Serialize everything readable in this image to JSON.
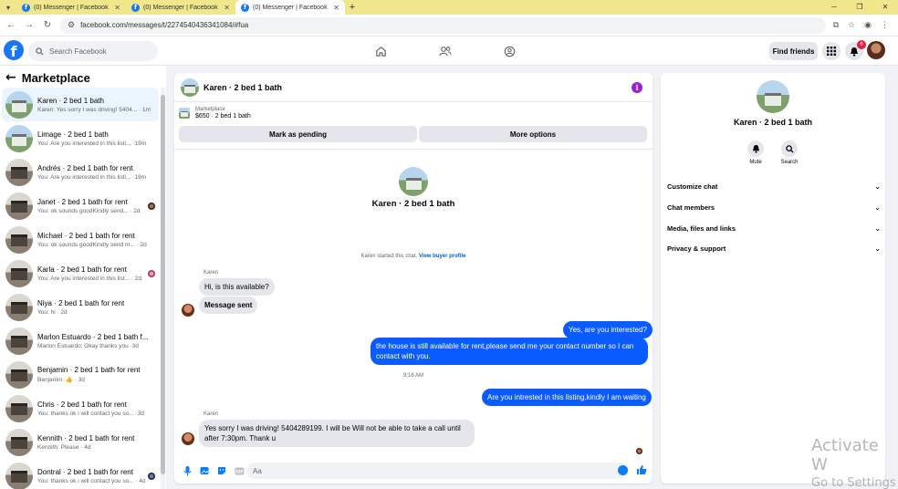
{
  "browser": {
    "tabs": [
      {
        "title": "(0) Messenger | Facebook"
      },
      {
        "title": "(0) Messenger | Facebook"
      },
      {
        "title": "(0) Messenger | Facebook"
      }
    ],
    "new_tab": "+",
    "url": "facebook.com/messages/t/2274540436341084/#fua"
  },
  "fb": {
    "logo": "f",
    "search_placeholder": "Search Facebook",
    "find_friends": "Find friends",
    "notifications_count": "6"
  },
  "sidebar": {
    "title": "Marketplace",
    "conversations": [
      {
        "name": "Karen · 2 bed 1 bath",
        "preview": "Karen: Yes sorry I was driving! 5404... · 1m",
        "thumb": "house",
        "selected": true,
        "mini": ""
      },
      {
        "name": "Limage · 2 bed 1 bath",
        "preview": "You: Are you interested in this listi... ·19m",
        "thumb": "house",
        "selected": false,
        "mini": ""
      },
      {
        "name": "Andrés · 2 bed 1 bath for rent",
        "preview": "You: Are you interested in this listi... ·19m",
        "thumb": "bw",
        "selected": false,
        "mini": ""
      },
      {
        "name": "Janet · 2 bed 1 bath for rent",
        "preview": "You: ok sounds goodKindly send... · 2d",
        "thumb": "bw",
        "selected": false,
        "mini": "brown"
      },
      {
        "name": "Michael · 2 bed 1 bath for rent",
        "preview": "You: ok sounds goodKindly send m... · 2d",
        "thumb": "bw",
        "selected": false,
        "mini": ""
      },
      {
        "name": "Karla · 2 bed 1 bath for rent",
        "preview": "You: Are you interested in this list... · 2d",
        "thumb": "bw",
        "selected": false,
        "mini": "pink"
      },
      {
        "name": "Niya · 2 bed 1 bath for rent",
        "preview": "You: hi · 2d",
        "thumb": "bw",
        "selected": false,
        "mini": ""
      },
      {
        "name": "Marlon Estuardo · 2 bed 1 bath f...",
        "preview": "Marlon Estuardo: Okay thanks you ·3d",
        "thumb": "bw",
        "selected": false,
        "mini": ""
      },
      {
        "name": "Benjamin · 2 bed 1 bath for rent",
        "preview": "Benjamin: 👍 · 3d",
        "thumb": "bw",
        "selected": false,
        "mini": ""
      },
      {
        "name": "Chris · 2 bed 1 bath for rent",
        "preview": "You: thanks ok i will contact you so... ·3d",
        "thumb": "bw",
        "selected": false,
        "mini": ""
      },
      {
        "name": "Kennith · 2 bed 1 bath for rent",
        "preview": "Kennith: Please · 4d",
        "thumb": "bw",
        "selected": false,
        "mini": ""
      },
      {
        "name": "Dontral · 2 bed 1 bath for rent",
        "preview": "You: thanks ok i will contact you so... · 4d",
        "thumb": "bw",
        "selected": false,
        "mini": "dark"
      }
    ]
  },
  "chat": {
    "title": "Karen · 2 bed 1 bath",
    "info_icon": "i",
    "listing_category": "Marketplace",
    "listing_price": "$650 · 2 bed 1 bath",
    "mark_pending": "Mark as pending",
    "more_options": "More options",
    "intro_name": "Karen · 2 bed 1 bath",
    "system_note": "Karen started this chat.",
    "view_buyer_profile": "View buyer profile",
    "sender_label_1": "Karen",
    "msg_in_1": "Hi, is this available?",
    "msg_in_2": "Message sent",
    "msg_out_1": "Yes, are you interested?",
    "msg_out_2": "the house is still available for rent,please send me your contact number so I can contact with you.",
    "time_sep": "9:16 AM",
    "msg_out_3": "Are you intrested in this listing,kindly I am waiting",
    "sender_label_2": "Karen",
    "msg_in_3": "Yes sorry I was driving! 5404289199. I will be Will not be able to take a call until after 7:30pm. Thank u",
    "composer_placeholder": "Aa"
  },
  "rpanel": {
    "name": "Karen · 2 bed 1 bath",
    "mute": "Mute",
    "search": "Search",
    "rows": [
      "Customize chat",
      "Chat members",
      "Media, files and links",
      "Privacy & support"
    ],
    "chevron": "⌄"
  },
  "watermark": {
    "line1": "Activate W",
    "line2": "Go to Settings"
  },
  "colors": {
    "fb_blue": "#1877f2",
    "bubble_out": "#0a5cff",
    "bubble_in": "#e4e6eb",
    "info_purple": "#9b1fd6",
    "tab_bar": "#f0e68c"
  }
}
